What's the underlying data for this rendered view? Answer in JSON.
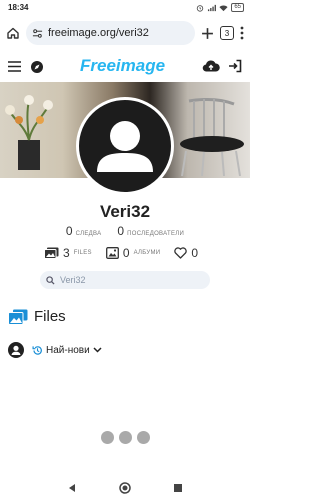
{
  "status": {
    "time": "18:34",
    "battery": "65"
  },
  "browser": {
    "url": "freeimage.org/veri32",
    "tabs_count": "3"
  },
  "site": {
    "logo_text": "Freeimage"
  },
  "profile": {
    "username": "Veri32",
    "following_count": "0",
    "following_label": "СЛЕДВА",
    "followers_count": "0",
    "followers_label": "ПОСЛЕДОВАТЕЛИ",
    "files_count": "3",
    "files_label": "FILES",
    "albums_count": "0",
    "albums_label": "АЛБУМИ",
    "likes_count": "0"
  },
  "search": {
    "placeholder": "Veri32"
  },
  "content": {
    "heading": "Files",
    "sort_label": "Най-нови"
  },
  "colors": {
    "brand": "#27b6f0",
    "accent": "#1a8fd6"
  }
}
